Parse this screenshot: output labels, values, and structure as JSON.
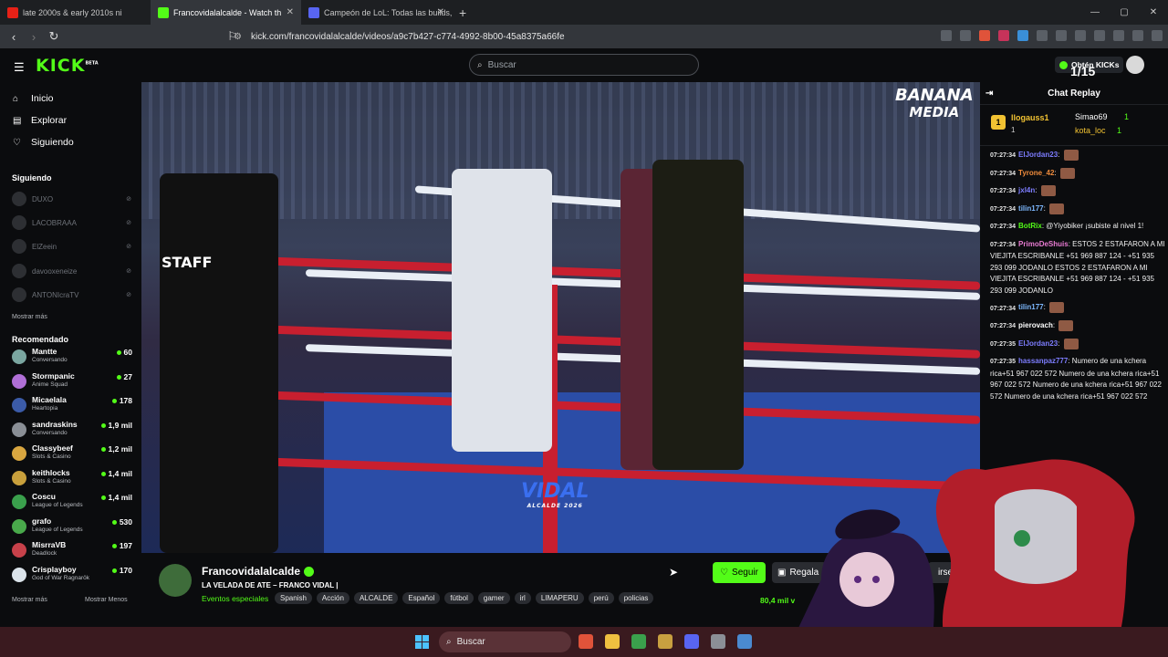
{
  "browser": {
    "tabs": [
      {
        "label": "late 2000s & early 2010s ni",
        "color": "#e62117"
      },
      {
        "label": "Francovidalalcalde - Watch th",
        "color": "#53fc18"
      },
      {
        "label": "Campeón de LoL: Todas las builds, tie",
        "color": "#5865f2"
      }
    ],
    "url": "kick.com/francovidalalcalde/videos/a9c7b427-c774-4992-8b00-45a8375a66fe"
  },
  "header": {
    "logo": "KICK",
    "logo_badge": "BETA",
    "search_placeholder": "Buscar",
    "get_kicks": "Obtén KICKs",
    "counter": "1/15"
  },
  "sidebar": {
    "nav": [
      {
        "label": "Inicio",
        "icon": "home-icon"
      },
      {
        "label": "Explorar",
        "icon": "compass-icon"
      },
      {
        "label": "Siguiendo",
        "icon": "heart-icon"
      }
    ],
    "following_title": "Siguiendo",
    "following": [
      "DUXO",
      "LACOBRAAA",
      "ElZeein",
      "davooxeneize",
      "ANTONIcraTV"
    ],
    "show_more": "Mostrar más",
    "recommended_title": "Recomendado",
    "recommended": [
      {
        "name": "Mantte",
        "category": "Conversando",
        "viewers": "60",
        "color": "#7aa6a0"
      },
      {
        "name": "Stormpanic",
        "category": "Anime Squad",
        "viewers": "27",
        "color": "#b06fd6"
      },
      {
        "name": "Micaelala",
        "category": "Heartopia",
        "viewers": "178",
        "color": "#3b5ba8"
      },
      {
        "name": "sandraskins",
        "category": "Conversando",
        "viewers": "1,9 mil",
        "color": "#8a8f96"
      },
      {
        "name": "Classybeef",
        "category": "Slots & Casino",
        "viewers": "1,2 mil",
        "color": "#d8a640"
      },
      {
        "name": "keithlocks",
        "category": "Slots & Casino",
        "viewers": "1,4 mil",
        "color": "#c9a03c"
      },
      {
        "name": "Coscu",
        "category": "League of Legends",
        "viewers": "1,4 mil",
        "color": "#3aa04c"
      },
      {
        "name": "grafo",
        "category": "League of Legends",
        "viewers": "530",
        "color": "#49a94b"
      },
      {
        "name": "MisrraVB",
        "category": "Deadlock",
        "viewers": "197",
        "color": "#c7414a"
      },
      {
        "name": "Crisplayboy",
        "category": "God of War Ragnarök",
        "viewers": "170",
        "color": "#dbe3ea"
      }
    ],
    "more": "Mostrar más",
    "less": "Mostrar Menos"
  },
  "video": {
    "watermark_top": "BANANA",
    "watermark_bottom": "MEDIA",
    "vidal": "VIDAL",
    "vidal_sub": "ALCALDE 2026",
    "staff": "STAFF"
  },
  "chat": {
    "title": "Chat Replay",
    "top_gifter": "llogauss1",
    "top_gifter_count": "1",
    "gifter2": "Simao69",
    "gifter2_count": "1",
    "gifter3": "kota_loc",
    "gifter3_count": "1",
    "messages": [
      {
        "time": "07:27:34",
        "user": "ElJordan23",
        "color": "#7d7dff",
        "text": "",
        "emote": true
      },
      {
        "time": "07:27:34",
        "user": "Tyrone_42",
        "color": "#f08c3c",
        "text": "",
        "emote": true
      },
      {
        "time": "07:27:34",
        "user": "jxl4n",
        "color": "#7d7dff",
        "text": "",
        "emote": true
      },
      {
        "time": "07:27:34",
        "user": "tilin177",
        "color": "#7db8ff",
        "text": "",
        "emote": true
      },
      {
        "time": "07:27:34",
        "user": "BotRix",
        "color": "#53fc18",
        "text": "@Yiyobiker ¡subiste al nivel 1!",
        "emote": false
      },
      {
        "time": "07:27:34",
        "user": "PrimoDeShuis",
        "color": "#e87bd2",
        "text": "ESTOS 2 ESTAFARON A MI VIEJITA ESCRIBANLE +51 969 887 124 - +51 935 293 099 JODANLO ESTOS 2 ESTAFARON A MI VIEJITA ESCRIBANLE +51 969 887 124 - +51 935 293 099 JODANLO",
        "emote": false
      },
      {
        "time": "07:27:34",
        "user": "tilin177",
        "color": "#7db8ff",
        "text": "",
        "emote": true
      },
      {
        "time": "07:27:34",
        "user": "pierovach",
        "color": "#ffffff",
        "text": "",
        "emote": true
      },
      {
        "time": "07:27:35",
        "user": "ElJordan23",
        "color": "#7d7dff",
        "text": "",
        "emote": true
      },
      {
        "time": "07:27:35",
        "user": "hassanpaz777",
        "color": "#7d7dff",
        "text": "Numero de una kchera rica+51 967 022 572 Numero de una kchera rica+51 967 022 572 Numero de una kchera rica+51 967 022 572 Numero de una kchera rica+51 967 022 572",
        "emote": false
      }
    ]
  },
  "meta": {
    "channel": "Francovidalalcalde",
    "subtitle": "LA VELADA DE ATE – FRANCO VIDAL |",
    "category": "Eventos especiales",
    "tags": [
      "Spanish",
      "Acción",
      "ALCALDE",
      "Español",
      "fútbol",
      "gamer",
      "irl",
      "LIMAPERU",
      "perú",
      "policias"
    ],
    "follow": "Seguir",
    "gift": "Regala",
    "subscribe": "irse",
    "views": "80,4 mil v"
  },
  "taskbar": {
    "search": "Buscar"
  },
  "colors": {
    "accent": "#53fc18",
    "background": "#0b0c0e"
  }
}
